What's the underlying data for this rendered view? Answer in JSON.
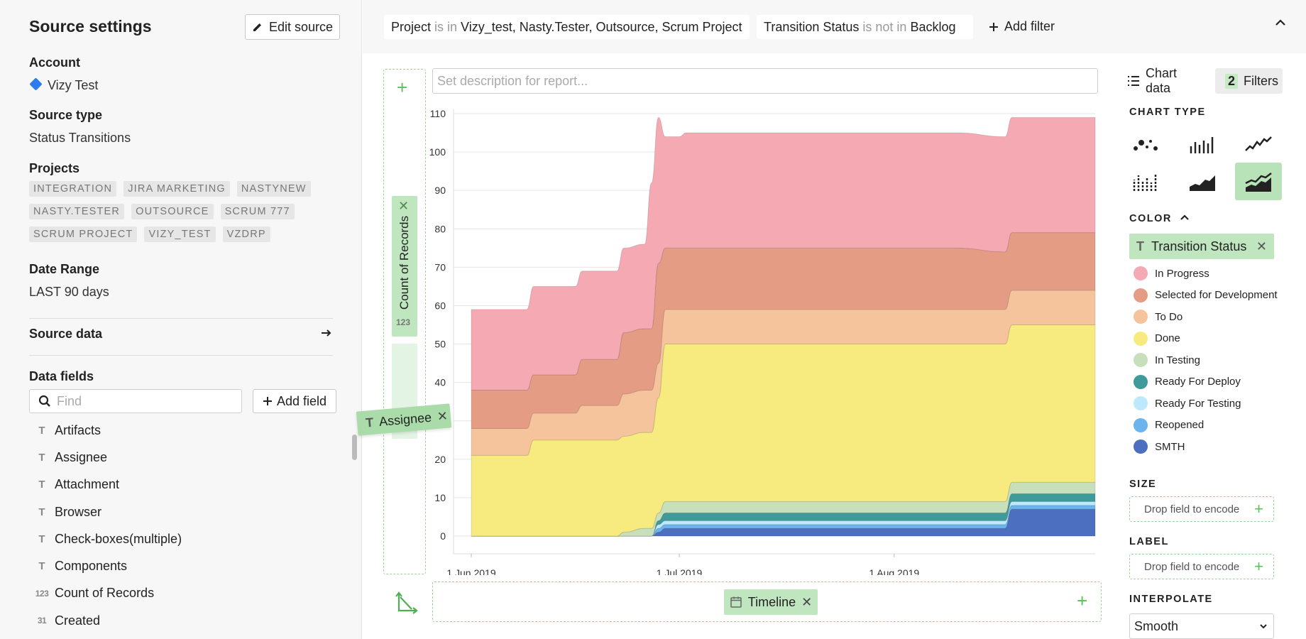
{
  "sidebar": {
    "title": "Source settings",
    "edit_label": "Edit source",
    "account_label": "Account",
    "account_value": "Vizy Test",
    "source_type_label": "Source type",
    "source_type_value": "Status Transitions",
    "projects_label": "Projects",
    "projects": [
      "INTEGRATION",
      "JIRA MARKETING",
      "NASTYNEW",
      "NASTY.TESTER",
      "OUTSOURCE",
      "SCRUM 777",
      "SCRUM PROJECT",
      "VIZY_TEST",
      "VZDRP"
    ],
    "date_range_label": "Date Range",
    "date_range_value": "LAST 90 days",
    "source_data_label": "Source data",
    "data_fields_label": "Data fields",
    "find_placeholder": "Find",
    "add_field_label": "Add field",
    "fields": [
      {
        "name": "Artifacts",
        "type": "T"
      },
      {
        "name": "Assignee",
        "type": "T"
      },
      {
        "name": "Attachment",
        "type": "T"
      },
      {
        "name": "Browser",
        "type": "T"
      },
      {
        "name": "Check-boxes(multiple)",
        "type": "T"
      },
      {
        "name": "Components",
        "type": "T"
      },
      {
        "name": "Count of Records",
        "type": "123"
      },
      {
        "name": "Created",
        "type": "31"
      }
    ]
  },
  "filters": [
    {
      "field": "Project",
      "op": "is in",
      "value": "Vizy_test, Nasty.Tester, Outsource, Scrum Project"
    },
    {
      "field": "Transition Status",
      "op": "is not in",
      "value": "Backlog"
    }
  ],
  "add_filter_label": "Add filter",
  "description_placeholder": "Set description for report...",
  "y_field": "Count of Records",
  "y_field_icon": "123",
  "dragging_field": "Assignee",
  "x_field": "Timeline",
  "panel": {
    "chart_data_label": "Chart data",
    "filters_count": "2",
    "filters_label": "Filters",
    "chart_type_title": "CHART TYPE",
    "color_title": "COLOR",
    "color_field": "Transition Status",
    "size_title": "SIZE",
    "label_title": "LABEL",
    "drop_text": "Drop field to encode",
    "interpolate_title": "INTERPOLATE",
    "interpolate_value": "Smooth",
    "chart_types": [
      "scatter-icon",
      "bar-icon",
      "line-icon",
      "strip-icon",
      "area-icon",
      "stacked-area-icon"
    ],
    "selected_chart_type": "stacked-area-icon"
  },
  "chart_data": {
    "type": "area",
    "stacked": true,
    "interpolation": "smooth",
    "ylim": [
      0,
      110
    ],
    "yticks": [
      0,
      10,
      20,
      30,
      40,
      50,
      60,
      70,
      80,
      90,
      100,
      110
    ],
    "xticks": [
      "1 Jun 2019",
      "1 Jul 2019",
      "1 Aug 2019"
    ],
    "x_day_values": [
      0,
      30,
      61
    ],
    "x_range_days": [
      0,
      90
    ],
    "x": [
      0,
      8,
      9,
      15,
      16,
      21,
      22,
      25,
      26,
      27,
      28,
      30,
      31,
      35,
      40,
      50,
      60,
      70,
      77,
      78,
      90
    ],
    "series": [
      {
        "name": "SMTH",
        "color": "#4c6fbf",
        "values": [
          0,
          0,
          0,
          0,
          0,
          0,
          0,
          0,
          0,
          1,
          2,
          2,
          2,
          2,
          2,
          2,
          2,
          2,
          2,
          7,
          7
        ]
      },
      {
        "name": "Reopened",
        "color": "#6bb4ee",
        "values": [
          0,
          0,
          0,
          0,
          0,
          0,
          0,
          0,
          0,
          1,
          1,
          1,
          1,
          1,
          1,
          1,
          1,
          1,
          1,
          1,
          1
        ]
      },
      {
        "name": "Ready For Testing",
        "color": "#bde9fb",
        "values": [
          0,
          0,
          0,
          0,
          0,
          0,
          0,
          0,
          0,
          1,
          1,
          1,
          1,
          1,
          1,
          1,
          1,
          1,
          1,
          1,
          1
        ]
      },
      {
        "name": "Ready For Deploy",
        "color": "#3f9a9a",
        "values": [
          0,
          0,
          0,
          0,
          0,
          0,
          0,
          0,
          0,
          1,
          2,
          2,
          2,
          2,
          2,
          2,
          2,
          2,
          2,
          2,
          2
        ]
      },
      {
        "name": "In Testing",
        "color": "#c7e0bb",
        "values": [
          0,
          0,
          0,
          0,
          0,
          0,
          1,
          2,
          2,
          2,
          3,
          3,
          3,
          3,
          3,
          3,
          3,
          3,
          3,
          3,
          3
        ]
      },
      {
        "name": "Done",
        "color": "#f7eb7f",
        "values": [
          21,
          21,
          25,
          25,
          25,
          25,
          25,
          25,
          25,
          30,
          41,
          41,
          41,
          41,
          41,
          41,
          41,
          41,
          41,
          41,
          41
        ]
      },
      {
        "name": "To Do",
        "color": "#f6c49c",
        "values": [
          7,
          7,
          7,
          7,
          9,
          9,
          11,
          11,
          11,
          9,
          9,
          9,
          9,
          9,
          9,
          9,
          9,
          9,
          9,
          9,
          9
        ]
      },
      {
        "name": "Selected for Development",
        "color": "#e59c84",
        "values": [
          10,
          10,
          10,
          10,
          12,
          12,
          16,
          16,
          16,
          26,
          16,
          16,
          16,
          16,
          16,
          16,
          16,
          16,
          15,
          15,
          15
        ]
      },
      {
        "name": "In Progress",
        "color": "#f4a9b3",
        "values": [
          21,
          21,
          23,
          23,
          23,
          23,
          22,
          22,
          38,
          38,
          29,
          29,
          30,
          30,
          30,
          30,
          30,
          30,
          30,
          30,
          30
        ]
      }
    ],
    "legend_order": [
      "In Progress",
      "Selected for Development",
      "To Do",
      "Done",
      "In Testing",
      "Ready For Deploy",
      "Ready For Testing",
      "Reopened",
      "SMTH"
    ],
    "grid": true
  }
}
